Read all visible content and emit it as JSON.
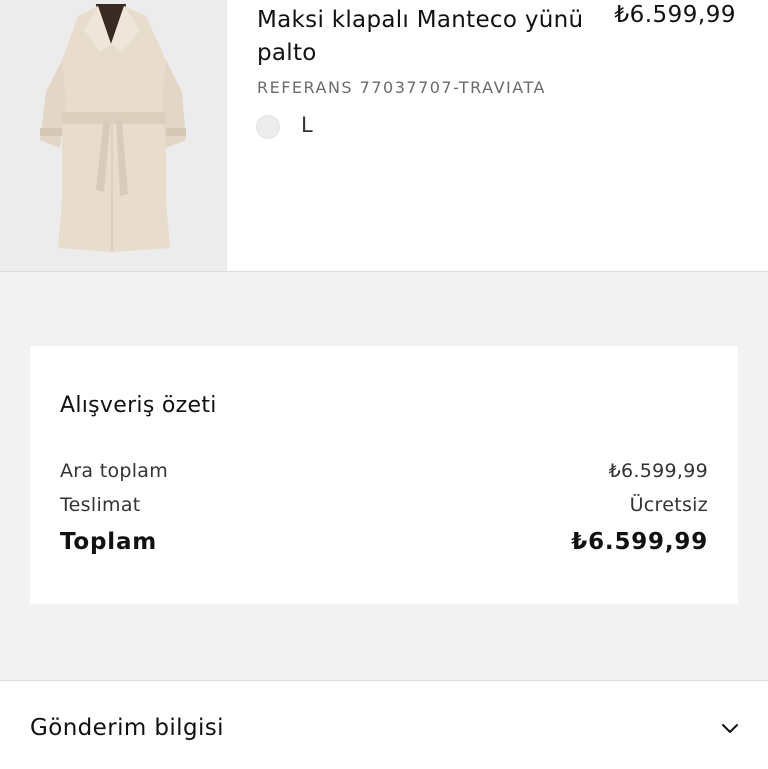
{
  "product": {
    "image_alt": "beige-wool-coat-image",
    "title": "Maksi klapalı Manteco yünü palto",
    "price": "₺6.599,99",
    "reference": "REFERANS 77037707-TRAVIATA",
    "size": "L",
    "color_swatch": "#ececec"
  },
  "summary": {
    "title": "Alışveriş özeti",
    "subtotal_label": "Ara toplam",
    "subtotal_value": "₺6.599,99",
    "delivery_label": "Teslimat",
    "delivery_value": "Ücretsiz",
    "total_label": "Toplam",
    "total_value": "₺6.599,99"
  },
  "shipping": {
    "label": "Gönderim bilgisi",
    "icon": "chevron-down-icon"
  }
}
